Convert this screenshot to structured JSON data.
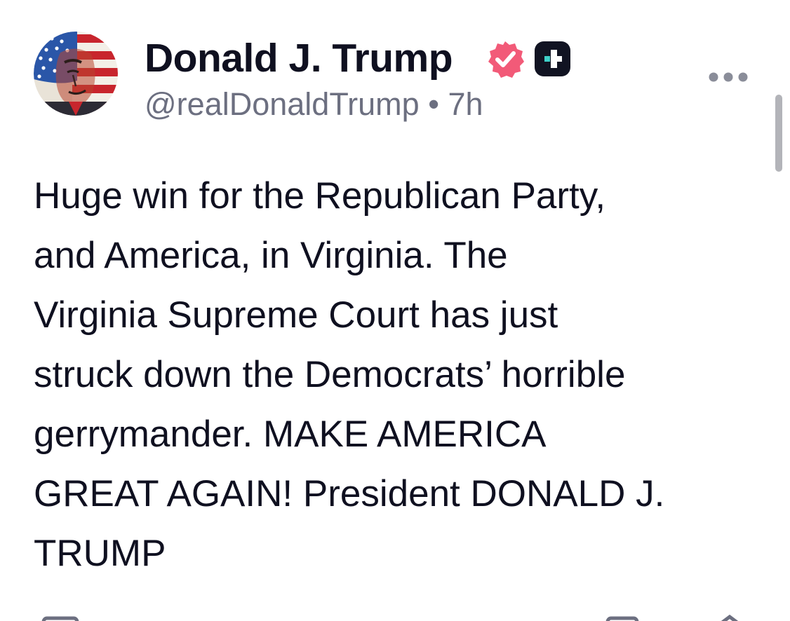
{
  "post": {
    "author": {
      "display_name": "Donald J. Trump",
      "handle": "@realDonaldTrump",
      "separator": "•",
      "time_ago": "7h",
      "verified_icon": "verified-badge-icon",
      "badge_icon": "plus-badge-icon"
    },
    "body": "Huge win for the Republican Party,\nand America, in Virginia. The\nVirginia Supreme Court has just\nstruck down the Democrats’ horrible\ngerrymander. MAKE AMERICA\nGREAT AGAIN! President DONALD J.\nTRUMP",
    "menu_icon": "more-options-icon"
  },
  "colors": {
    "text": "#0f1020",
    "secondary_text": "#6c6f80",
    "verified": "#f25a78",
    "badge": "#111322",
    "badge_accent": "#3fd0c9"
  }
}
